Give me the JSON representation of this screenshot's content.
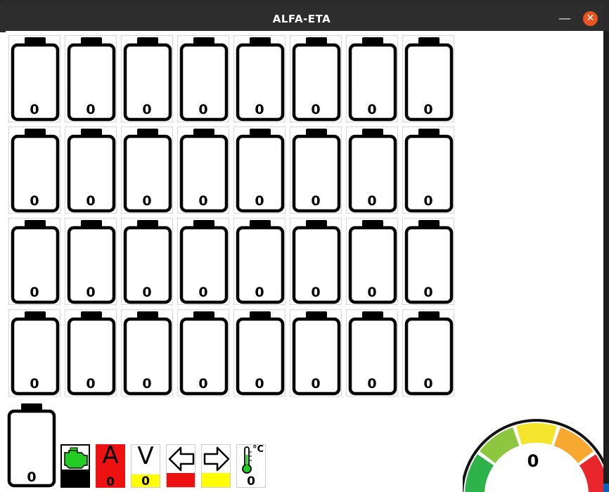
{
  "window": {
    "title": "ALFA-ETA"
  },
  "cells": {
    "rows": [
      [
        "0",
        "0",
        "0",
        "0",
        "0",
        "0",
        "0",
        "0"
      ],
      [
        "0",
        "0",
        "0",
        "0",
        "0",
        "0",
        "0",
        "0"
      ],
      [
        "0",
        "0",
        "0",
        "0",
        "0",
        "0",
        "0",
        "0"
      ],
      [
        "0",
        "0",
        "0",
        "0",
        "0",
        "0",
        "0",
        "0"
      ],
      [
        "0"
      ]
    ]
  },
  "status": {
    "engine": {
      "icon": "engine-icon",
      "color": "#22cc22"
    },
    "current": {
      "letter": "A",
      "value": "0",
      "color": "#ee1111"
    },
    "voltage": {
      "letter": "V",
      "value": "0",
      "color": "#ffff00"
    },
    "left_arrow": {
      "icon": "arrow-left-icon",
      "color": "#ee1111"
    },
    "right_arrow": {
      "icon": "arrow-right-icon",
      "color": "#ffff00"
    },
    "temperature": {
      "icon": "thermometer-icon",
      "unit": "°C",
      "value": "0",
      "color": "#22cc22"
    }
  },
  "gauge": {
    "value": "0",
    "colors": [
      "#2db34a",
      "#8dc63f",
      "#f4e52c",
      "#f7a830",
      "#e8262c"
    ]
  }
}
